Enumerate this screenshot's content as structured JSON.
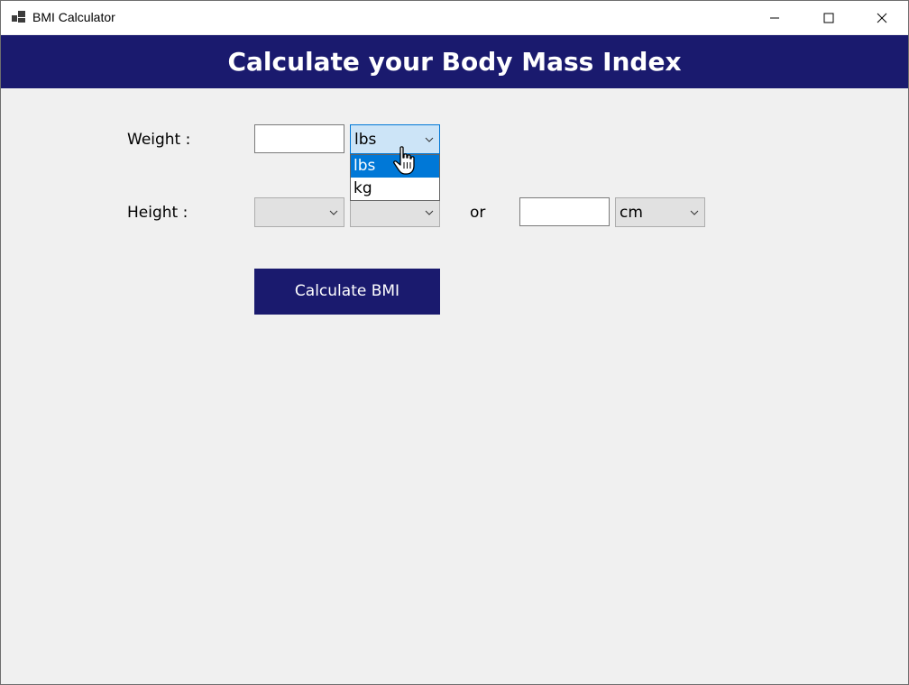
{
  "window": {
    "title": "BMI Calculator",
    "controls": [
      "minimize",
      "maximize",
      "close"
    ]
  },
  "header": {
    "title": "Calculate your Body Mass Index",
    "background": "#1a1a6e",
    "text_color": "#ffffff"
  },
  "form": {
    "weight": {
      "label": "Weight :",
      "input_value": "",
      "unit_selected": "lbs",
      "unit_options": [
        "lbs",
        "kg"
      ],
      "dropdown_open": true,
      "highlighted_option": "lbs"
    },
    "height": {
      "label": "Height :",
      "feet_value": "",
      "inches_value": "",
      "separator": "or",
      "cm_input_value": "",
      "cm_unit_selected": "cm"
    },
    "calculate_label": "Calculate BMI"
  },
  "colors": {
    "accent": "#1a1a6e",
    "selection": "#0078d7",
    "combo_focus": "#cce4f7"
  }
}
